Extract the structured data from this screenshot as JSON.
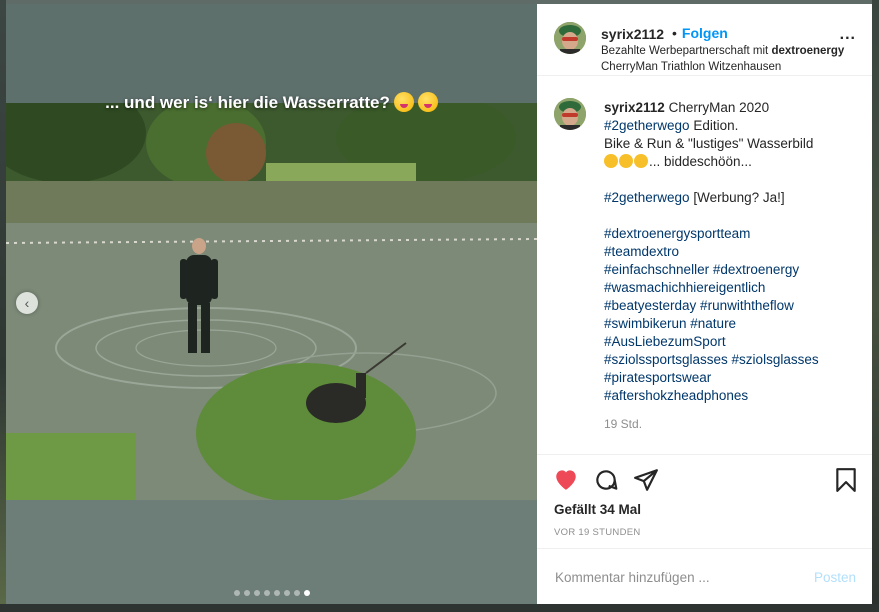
{
  "post": {
    "username": "syrix2112",
    "follow_label": "Folgen",
    "separator": "•",
    "paid_partnership_prefix": "Bezahlte Werbepartnerschaft mit ",
    "partner": "dextroenergy",
    "location": "CherryMan Triathlon Witzenhausen",
    "more_label": "..."
  },
  "media": {
    "overlay_text": "... und wer is‘ hier die Wasserratte?",
    "prev_label": "‹",
    "dots_total": 8,
    "active_dot": 8
  },
  "caption": {
    "username": "syrix2112",
    "line1_text": " CherryMan 2020",
    "line2_tag": "#2getherwego",
    "line2_text": " Edition.",
    "line3": "Bike & Run & \"lustiges\" Wasserbild",
    "line4_text": "... biddeschöön...",
    "line6_tag": "#2getherwego",
    "line6_text": " [Werbung? Ja!]",
    "tags": [
      "#dextroenergysportteam",
      "#teamdextro",
      "#einfachschneller #dextroenergy",
      "#wasmachichhiereigentlich",
      "#beatyesterday #runwiththeflow",
      "#swimbikerun #nature",
      "#AusLiebezumSport",
      "#sziolssportsglasses #sziolsglasses",
      "#piratesportswear",
      "#aftershokzheadphones"
    ],
    "time": "19 Std."
  },
  "actions": {
    "likes": "Gefällt 34 Mal",
    "age": "VOR 19 STUNDEN",
    "heart_color": "#ed4956"
  },
  "comment": {
    "placeholder": "Kommentar hinzufügen ...",
    "post_label": "Posten"
  }
}
